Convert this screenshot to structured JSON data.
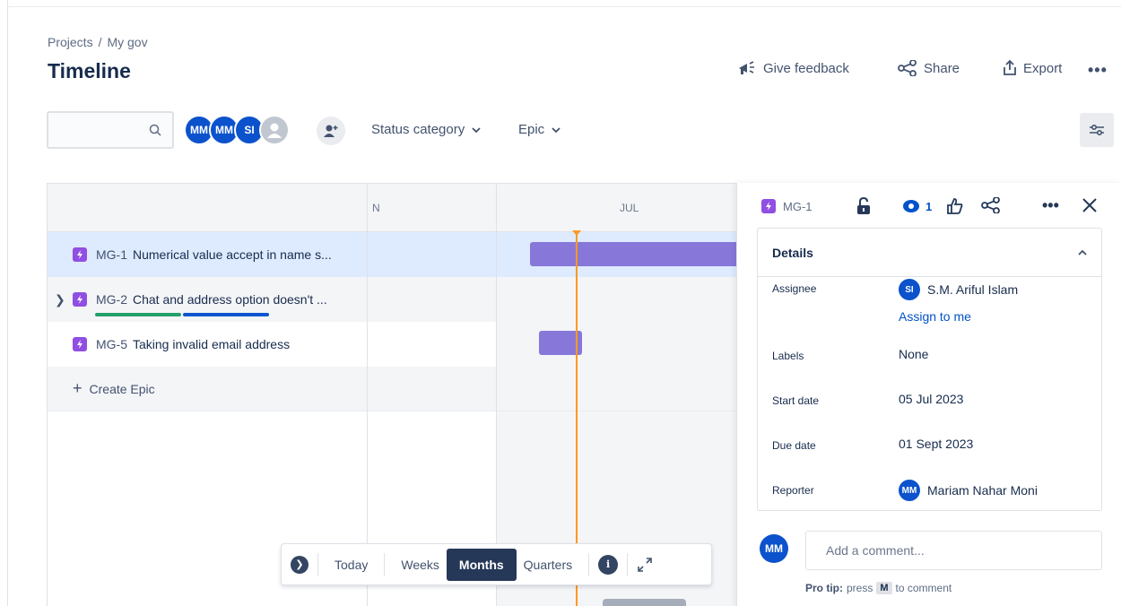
{
  "breadcrumb": {
    "projects": "Projects",
    "sep": "/",
    "project": "My gov"
  },
  "page_title": "Timeline",
  "header": {
    "feedback": "Give feedback",
    "share": "Share",
    "export": "Export",
    "more": "•••"
  },
  "search": {
    "placeholder": "",
    "value": ""
  },
  "avatars": [
    "MM",
    "MM",
    "SI"
  ],
  "filters": {
    "status": "Status category",
    "epic": "Epic"
  },
  "timeline": {
    "months": [
      "N",
      "JUL"
    ],
    "rows": [
      {
        "key": "MG-1",
        "summary": "Numerical value accept in name s...",
        "selected": true
      },
      {
        "key": "MG-2",
        "summary": "Chat and address option doesn't ...",
        "expandable": true
      },
      {
        "key": "MG-5",
        "summary": "Taking invalid email address"
      }
    ],
    "create": "Create Epic",
    "create_plus": "+"
  },
  "zoom": {
    "today": "Today",
    "weeks": "Weeks",
    "months": "Months",
    "quarters": "Quarters",
    "active": "Months"
  },
  "panel": {
    "key": "MG-1",
    "watchers": "1",
    "more": "•••",
    "details_title": "Details",
    "assignee_label": "Assignee",
    "assignee_initials": "SI",
    "assignee_name": "S.M. Ariful Islam",
    "assign_to_me": "Assign to me",
    "labels_label": "Labels",
    "labels_value": "None",
    "start_label": "Start date",
    "start_value": "05 Jul 2023",
    "due_label": "Due date",
    "due_value": "01 Sept 2023",
    "reporter_label": "Reporter",
    "reporter_initials": "MM",
    "reporter_name": "Mariam Nahar Moni",
    "comment_avatar": "MM",
    "comment_placeholder": "Add a comment...",
    "protip_bold": "Pro tip:",
    "protip_text1": "press",
    "protip_key": "M",
    "protip_text2": "to comment"
  },
  "colors": {
    "epic": "#904ee2",
    "bar": "#8777d9",
    "today": "#ff991f",
    "avatar": "#0b52cc"
  }
}
